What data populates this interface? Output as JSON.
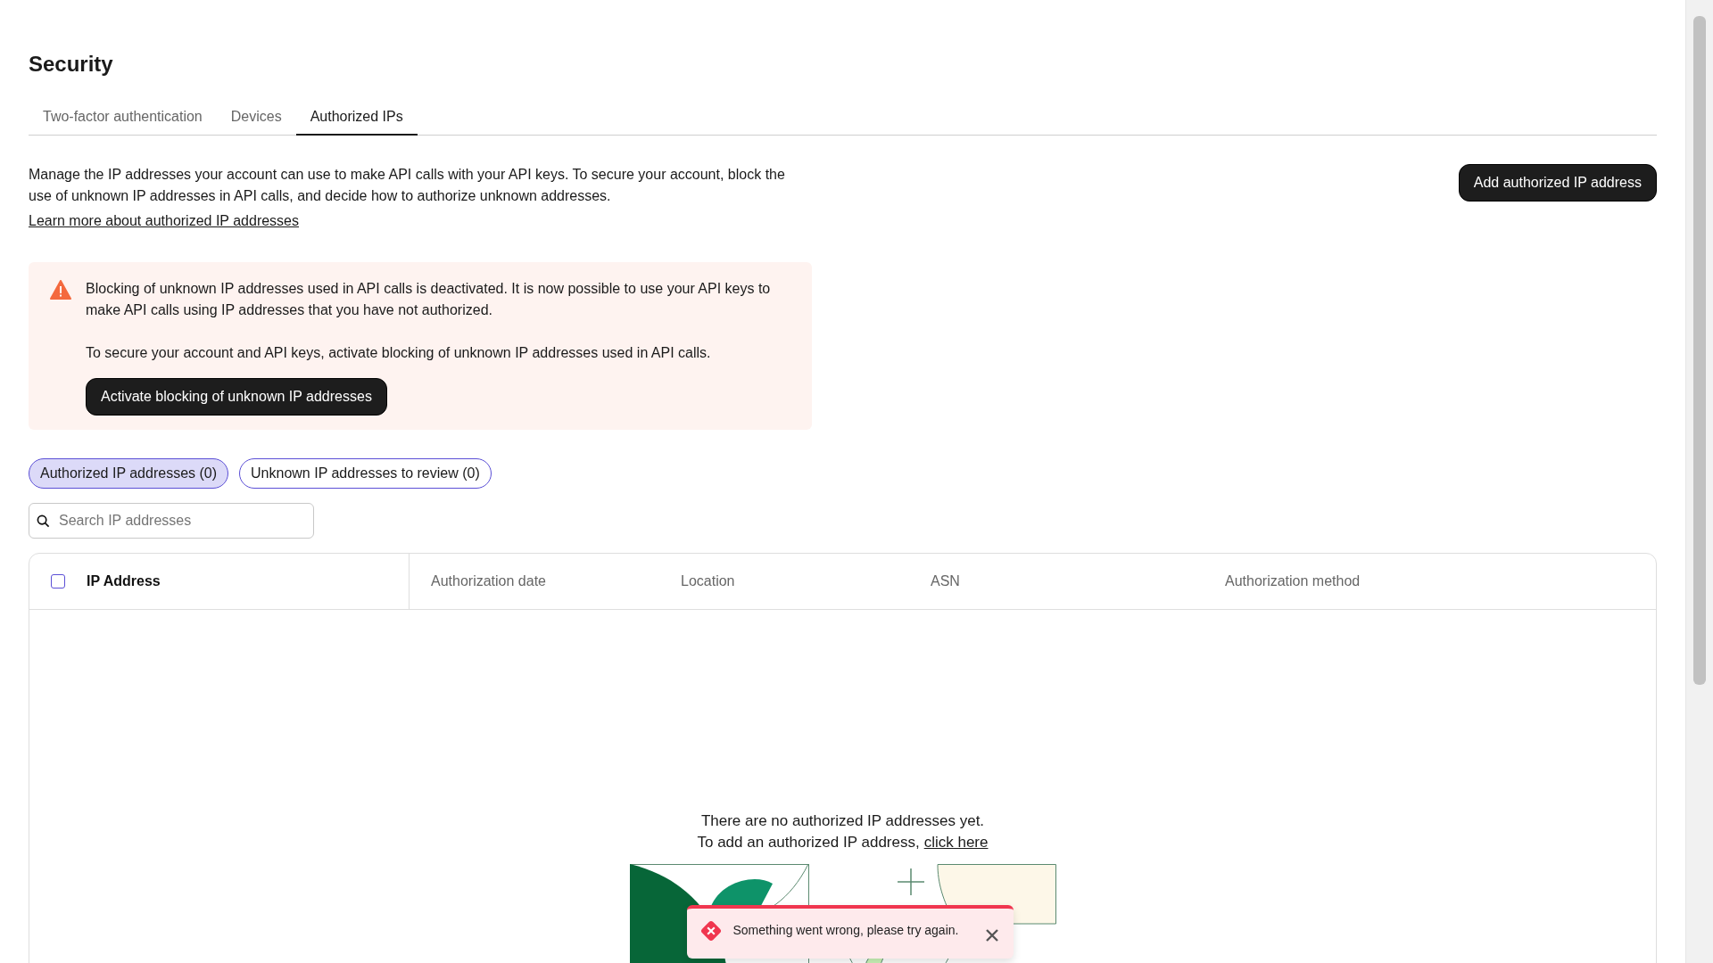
{
  "title": "Security",
  "tabs": [
    {
      "label": "Two-factor authentication",
      "selected": false
    },
    {
      "label": "Devices",
      "selected": false
    },
    {
      "label": "Authorized IPs",
      "selected": true
    }
  ],
  "description": "Manage the IP addresses your account can use to make API calls with your API keys. To secure your account, block the use of unknown IP addresses in API calls, and decide how to authorize unknown addresses.",
  "learn_more_link": "Learn more about authorized IP addresses",
  "add_button": "Add authorized IP address",
  "alert": {
    "message": "Blocking of unknown IP addresses used in API calls is deactivated. It is now possible to use your API keys to make API calls using IP addresses that you have not authorized.",
    "instruction": "To secure your account and API keys, activate blocking of unknown IP addresses used in API calls.",
    "button": "Activate blocking of unknown IP addresses"
  },
  "filters": [
    {
      "label": "Authorized IP addresses (0)",
      "selected": true
    },
    {
      "label": "Unknown IP addresses to review (0)",
      "selected": false
    }
  ],
  "search": {
    "placeholder": "Search IP addresses"
  },
  "table": {
    "select_all_checked": false,
    "columns": [
      "IP Address",
      "Authorization date",
      "Location",
      "ASN",
      "Authorization method"
    ]
  },
  "empty_state": {
    "message": "There are no authorized IP addresses yet.",
    "prefix": "To add an authorized IP address,",
    "link": "click here"
  },
  "toast": {
    "message": "Something went wrong, please try again."
  }
}
